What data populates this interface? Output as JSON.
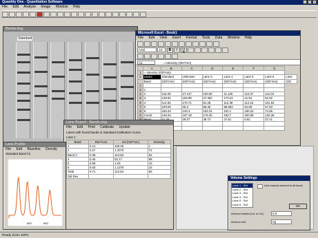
{
  "app": {
    "title": "Quantity One - Quantitation Software",
    "menu": [
      "File",
      "Edit",
      "Analyze",
      "Image",
      "Window",
      "Help"
    ]
  },
  "image_window": {
    "title": "Bands.img",
    "standard_label": "Standard",
    "lanes": [
      {
        "bands": [
          0.12,
          0.2,
          0.31,
          0.42,
          0.52,
          0.6,
          0.69,
          0.8
        ]
      },
      {
        "bands": [
          0.15,
          0.3,
          0.45,
          0.55
        ]
      },
      {
        "bands": [
          0.2,
          0.35,
          0.5,
          0.58
        ]
      },
      {
        "bands": [
          0.18,
          0.28,
          0.4,
          0.52,
          0.62
        ]
      },
      {
        "bands": [
          0.16,
          0.33,
          0.5,
          0.62
        ]
      },
      {
        "bands": [
          0.22,
          0.36,
          0.48,
          0.6
        ]
      },
      {
        "bands": [
          0.2,
          0.34,
          0.46,
          0.58
        ]
      }
    ]
  },
  "excel": {
    "title": "Microsoft Excel - Book1",
    "menu": [
      "File",
      "Edit",
      "View",
      "Insert",
      "Format",
      "Tools",
      "Data",
      "Window",
      "Help"
    ],
    "font_name": "Arial",
    "font_size": "10",
    "cell_ref": "A1",
    "formula": "= Intensity (OD*mm)",
    "cell_a1_text": "= Intensity (OD*mm)",
    "columns": [
      "",
      "A",
      "B",
      "C",
      "D",
      "E",
      "F",
      "G"
    ],
    "header_row": [
      "Lanes",
      "Standard",
      "Unknown",
      "Lane 3",
      "Lane 4",
      "Lane 5",
      "Lane 6",
      "Lane"
    ],
    "unit_row": [
      "Band",
      "(OD*mm)",
      "(OD*mm)",
      "(OD*mm)",
      "(OD*mm)",
      "(OD*mm)",
      "(OD*mm)",
      "(OD"
    ],
    "rows": [
      [
        "1",
        "",
        "",
        "",
        "",
        "",
        "",
        ""
      ],
      [
        "3",
        "1",
        "",
        "",
        "",
        "",
        "",
        ""
      ],
      [
        "4",
        "2",
        "115.28",
        "27.217",
        "100.00",
        "11.125",
        "110.37",
        "112.04"
      ],
      [
        "5",
        "3",
        "138.91",
        "150.88",
        "47.382",
        "173.24",
        "41.54",
        "52.52"
      ],
      [
        "6",
        "4",
        "112.83",
        "170.71",
        "81.28",
        "113.38",
        "112.16",
        "101.92"
      ],
      [
        "7",
        "5",
        "100.00",
        "25.2",
        "86.36",
        "88.883",
        "64.58",
        "57.53"
      ],
      [
        "8",
        "6",
        "150.43",
        "140.4",
        "153.31",
        "151.1",
        "150.22",
        "74.56"
      ],
      [
        "9",
        "Count",
        "145.44",
        "167.18",
        "175.25",
        "160.7",
        "160.58",
        "132.28"
      ],
      [
        "10",
        "Mean",
        "11.20",
        "28.07",
        "38.72",
        "47.61",
        "6.82",
        "37.41"
      ],
      [
        "11",
        "Std Dev",
        "",
        "",
        "",
        "",
        "",
        ""
      ],
      [
        "12",
        "",
        "",
        "",
        "",
        "",
        "",
        ""
      ]
    ],
    "sheet_tab": "Sheet1"
  },
  "report": {
    "title": "Lane Report - Bands.img",
    "menu": [
      "File",
      "Edit",
      "Print",
      "Calibrate",
      "Update"
    ],
    "subtitle": "Lanes with found bands in Standard Calibration Curve",
    "lane_label": "Lane 1",
    "columns": [
      "Band",
      "Rel.Front",
      "Vol (OD*mm)",
      "Intensity"
    ],
    "rows": [
      [
        "1",
        "0.12",
        "100.00",
        "1"
      ],
      [
        "2",
        "0.27",
        "1.2070",
        "72"
      ],
      [
        "Band 3",
        "0.38",
        "113.53",
        "81"
      ],
      [
        "4",
        "0.46",
        "52.17",
        "98"
      ],
      [
        "5",
        "0.59",
        "1.03",
        "10"
      ],
      [
        "6",
        "0.63",
        "1.1370",
        "15"
      ],
      [
        "Total",
        "0.71",
        "112.84",
        "82"
      ],
      [
        "Std Dev",
        "",
        "",
        ""
      ]
    ]
  },
  "profile": {
    "title": "Lane Profile",
    "menu": [
      "File",
      "Edit",
      "Baseline",
      "Density"
    ],
    "subtitle": "Standard Band #1",
    "axis_ticks": [
      "800",
      "600"
    ],
    "peaks": [
      0.18,
      0.35,
      0.55,
      0.78
    ]
  },
  "volume_dialog": {
    "title": "Volume Settings",
    "list": [
      "Lane 1 - Std",
      "Lane 2 - Std",
      "Lane 3 - Std",
      "Lane 4 - Std",
      "Lane 5 - Std",
      "Lane 6 - Std"
    ],
    "checkbox_label": "Use manual amount in all lanes",
    "ok_label": "OK",
    "field1_label": "Amount loaded (mL or mL)",
    "field1_value": "0.0",
    "field2_label": "Amount unit",
    "field2_value": "ng"
  },
  "status_bar": {
    "text": "Ready  Zoom 100%"
  },
  "colors": {
    "title_active": "#0a246a",
    "profile_line": "#e06020",
    "lane_overlay": "#ff8000"
  }
}
